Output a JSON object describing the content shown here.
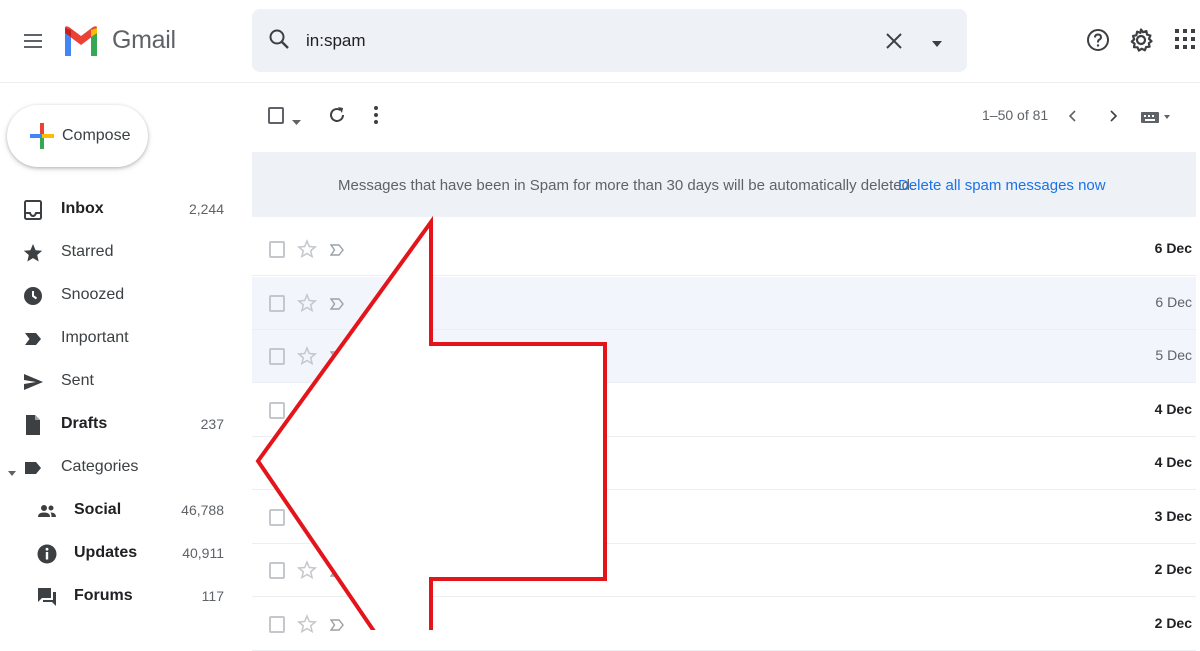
{
  "header": {
    "app_name": "Gmail",
    "search_value": "in:spam",
    "icons": [
      "menu-icon",
      "gmail-logo",
      "search-icon",
      "clear-icon",
      "search-options-icon",
      "help-icon",
      "gear-icon",
      "apps-icon"
    ]
  },
  "sidebar": {
    "compose_label": "Compose",
    "items": [
      {
        "label": "Inbox",
        "count": "2,244",
        "icon": "inbox-icon",
        "bold": true
      },
      {
        "label": "Starred",
        "count": "",
        "icon": "star-icon",
        "bold": false
      },
      {
        "label": "Snoozed",
        "count": "",
        "icon": "clock-icon",
        "bold": false
      },
      {
        "label": "Important",
        "count": "",
        "icon": "important-icon",
        "bold": false
      },
      {
        "label": "Sent",
        "count": "",
        "icon": "send-icon",
        "bold": false
      },
      {
        "label": "Drafts",
        "count": "237",
        "icon": "draft-icon",
        "bold": true
      },
      {
        "label": "Categories",
        "count": "",
        "icon": "label-icon",
        "bold": false
      },
      {
        "label": "Social",
        "count": "46,788",
        "icon": "people-icon",
        "bold": true
      },
      {
        "label": "Updates",
        "count": "40,911",
        "icon": "info-icon",
        "bold": true
      },
      {
        "label": "Forums",
        "count": "117",
        "icon": "forum-icon",
        "bold": true
      }
    ]
  },
  "toolbar": {
    "pagination": "1–50 of 81"
  },
  "banner": {
    "message": "Messages that have been in Spam for more than 30 days will be automatically deleted.",
    "link": "Delete all spam messages now"
  },
  "messages": [
    {
      "date": "6 Dec",
      "read": false
    },
    {
      "date": "6 Dec",
      "read": true
    },
    {
      "date": "5 Dec",
      "read": true
    },
    {
      "date": "4 Dec",
      "read": false
    },
    {
      "date": "4 Dec",
      "read": false
    },
    {
      "date": "3 Dec",
      "read": false
    },
    {
      "date": "2 Dec",
      "read": false
    },
    {
      "date": "2 Dec",
      "read": false
    }
  ],
  "annotation": {
    "arrow_color": "#e4141b",
    "direction": "left"
  },
  "colors": {
    "accent_blue": "#1a73e8",
    "banner_bg": "#eef1f5",
    "read_row_bg": "#f2f6fc"
  }
}
